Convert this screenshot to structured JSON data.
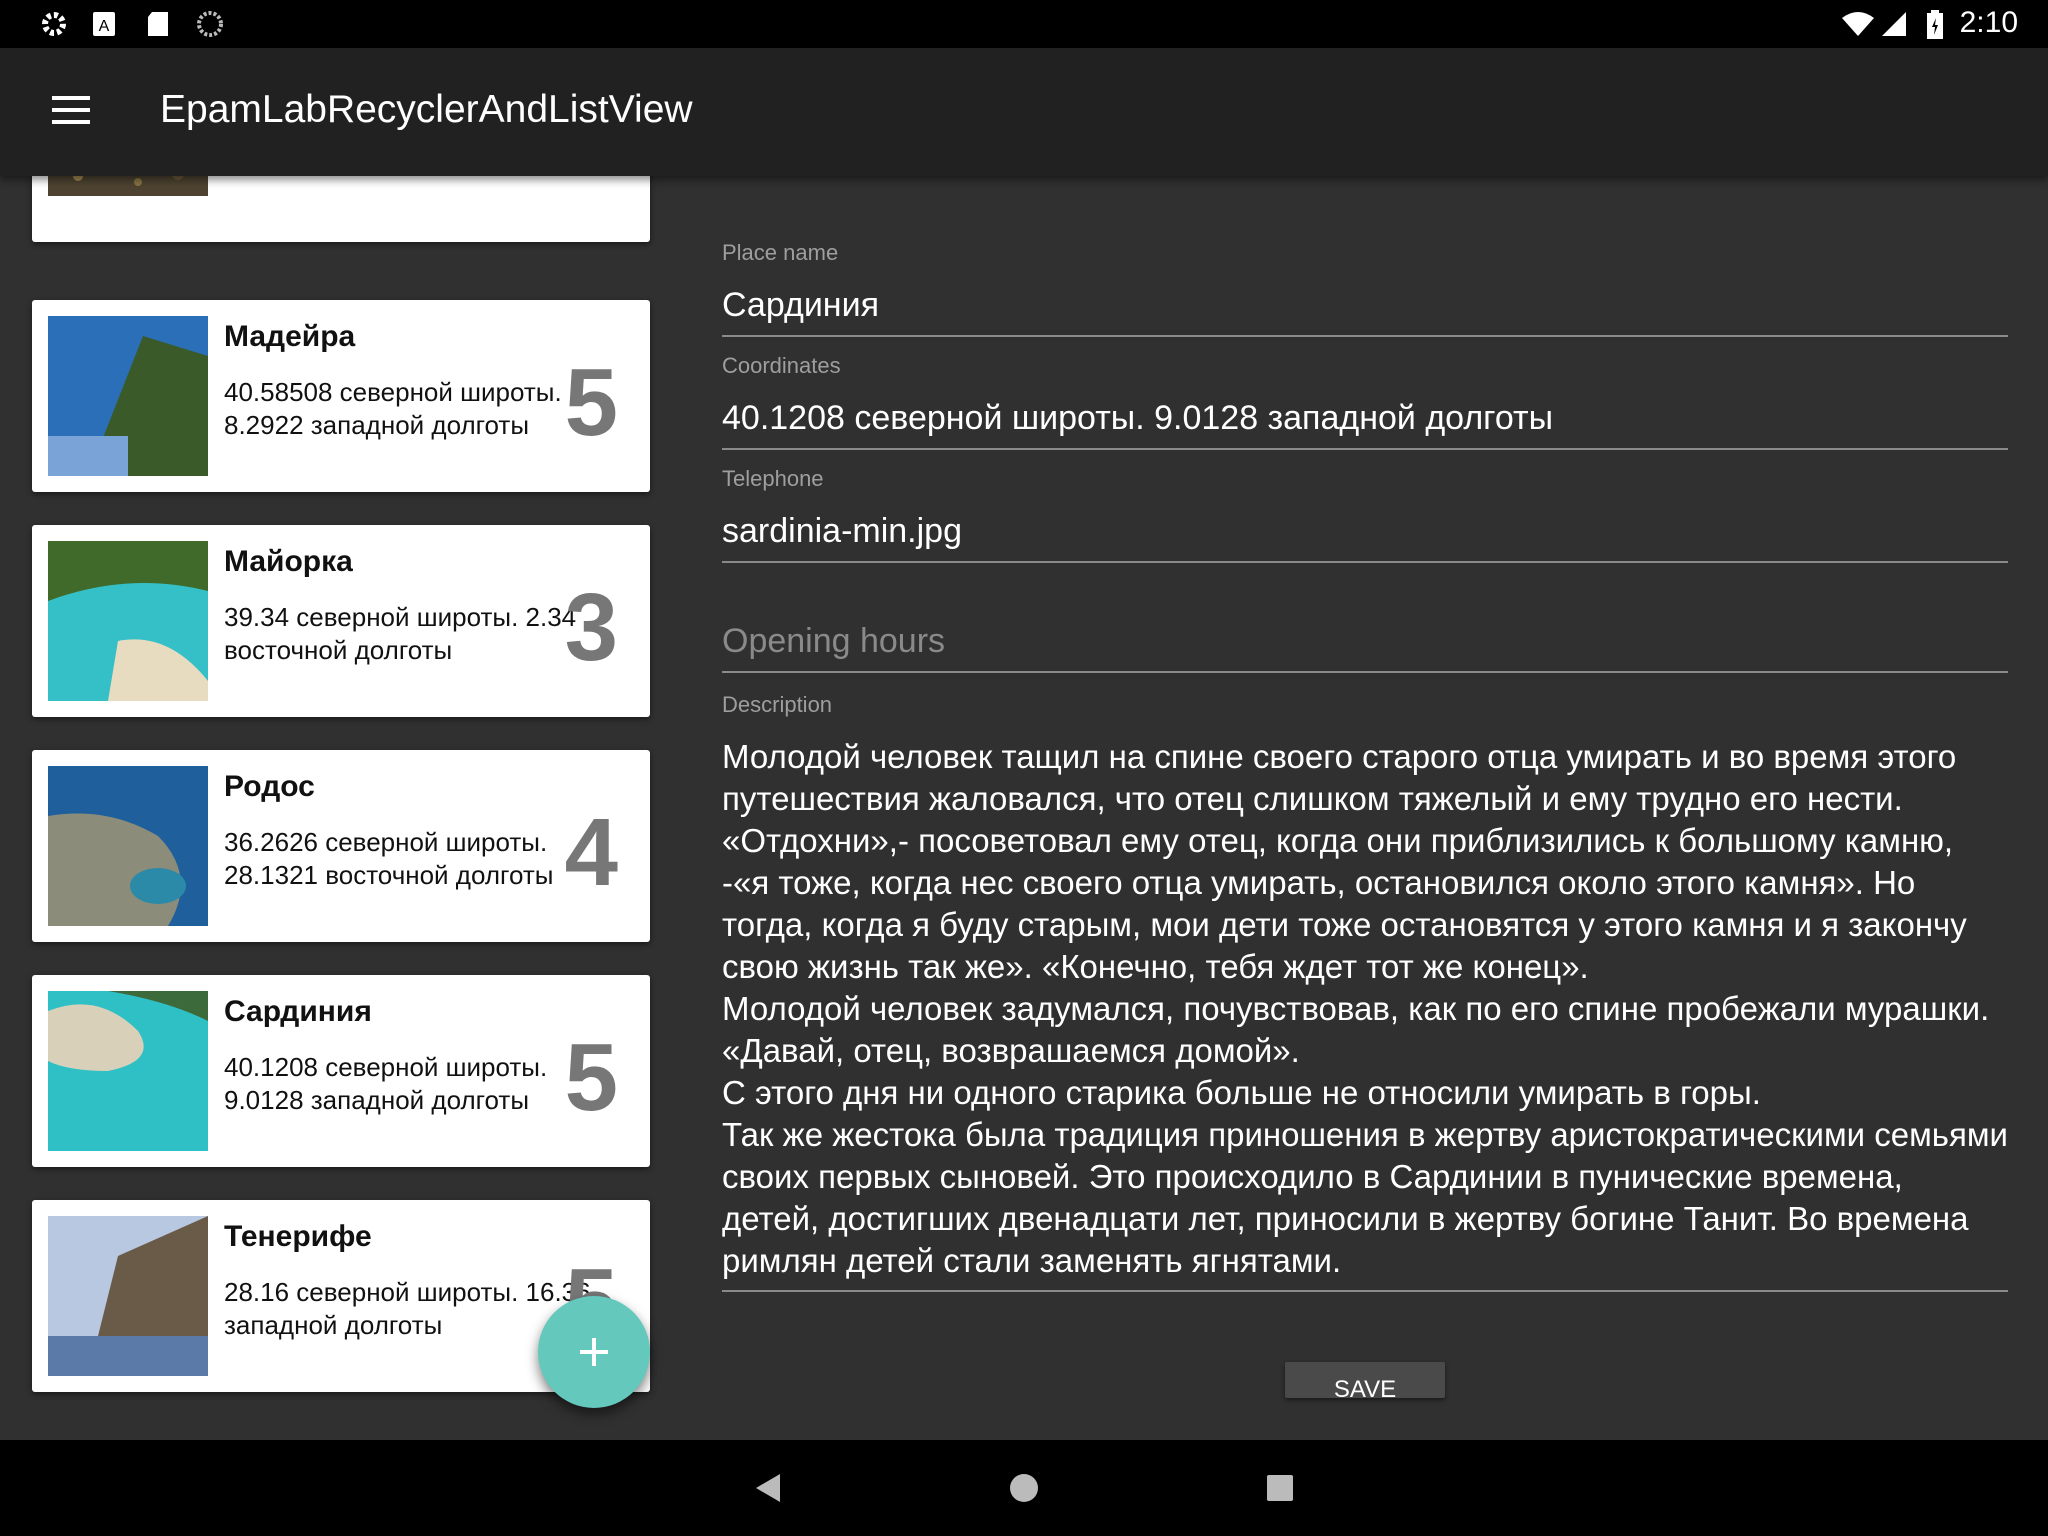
{
  "status_bar": {
    "time": "2:10",
    "left_icons": [
      "settings-icon",
      "a-box-icon",
      "sd-card-icon",
      "sync-circle-icon"
    ],
    "right_icons": [
      "wifi-icon",
      "signal-icon",
      "battery-icon"
    ]
  },
  "app_bar": {
    "menu_icon": "hamburger-menu-icon",
    "title": "EpamLabRecyclerAndListView"
  },
  "places": [
    {
      "name": "Мадейра",
      "coordinates": "40.58508 северной широты. 8.2922 западной долготы",
      "rating": "5",
      "colors": [
        "#2b6fb8",
        "#3a5a2a",
        "#7aa4d8"
      ]
    },
    {
      "name": "Майорка",
      "coordinates": "39.34 северной широты. 2.34 восточной долготы",
      "rating": "3",
      "colors": [
        "#35c0c8",
        "#3f6a2a",
        "#e8dcc0"
      ]
    },
    {
      "name": "Родос",
      "coordinates": "36.2626 северной широты. 28.1321 восточной долготы",
      "rating": "4",
      "colors": [
        "#1e5f9c",
        "#8c8c7a",
        "#2a8aa8"
      ]
    },
    {
      "name": "Сардиния",
      "coordinates": "40.1208 северной широты. 9.0128 западной долготы",
      "rating": "5",
      "colors": [
        "#2fc0c6",
        "#d8d0b8",
        "#3d6a3a"
      ]
    },
    {
      "name": "Тенерифе",
      "coordinates": "28.16 северной широты. 16.36 западной долготы",
      "rating": "5",
      "colors": [
        "#5b7aa8",
        "#6a5a48",
        "#b8c8e0"
      ]
    }
  ],
  "form": {
    "place_name_label": "Place name",
    "place_name_value": "Сардиния",
    "coordinates_label": "Coordinates",
    "coordinates_value": "40.1208 северной широты. 9.0128 западной долготы",
    "telephone_label": "Telephone",
    "telephone_value": "sardinia-min.jpg",
    "opening_hours_hint": "Opening hours",
    "description_label": "Description",
    "description_value": "Молодой человек тащил на спине своего старого отца умирать и во время этого путешествия жаловался, что отец слишком тяжелый и ему трудно его нести. «Отдохни»,- посоветовал ему отец, когда они приблизились к большому камню, -«я тоже, когда нес своего отца умирать, остановился около этого камня». Но тогда, когда я буду старым, мои дети тоже остановятся у этого камня и я закончу свою жизнь так же». «Конечно, тебя ждет тот же конец».\nМолодой человек задумался, почувствовав, как по его спине пробежали мурашки. «Давай, отец, возврашаемся домой».\nС этого дня ни одного старика больше не относили умирать в горы.\nТак же жестока была традиция приношения в жертву аристократическими семьями своих первых сыновей. Это происходило в Сардинии в пунические времена, детей, достигших двенадцати лет, приносили в жертву богине Танит. Во времена римлян детей стали заменять ягнятами.",
    "save_label": "SAVE"
  },
  "fab": {
    "icon": "plus-icon"
  },
  "nav_bar": {
    "icons": [
      "back-icon",
      "home-icon",
      "recents-icon"
    ]
  },
  "colors": {
    "background": "#303030",
    "app_bar": "#212121",
    "fab": "#64c8bd",
    "card": "#ffffff"
  }
}
